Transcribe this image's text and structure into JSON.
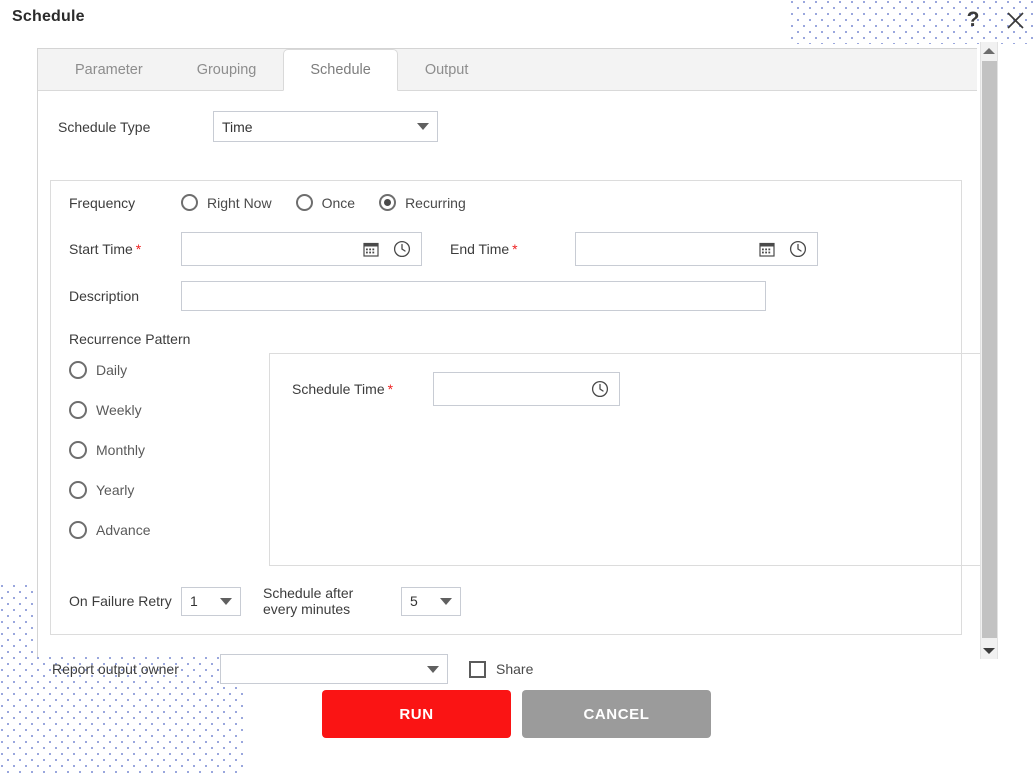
{
  "header": {
    "title": "Schedule",
    "help_icon": "question-mark-icon",
    "close_icon": "close-icon"
  },
  "tabs": [
    {
      "label": "Parameter",
      "active": false
    },
    {
      "label": "Grouping",
      "active": false
    },
    {
      "label": "Schedule",
      "active": true
    },
    {
      "label": "Output",
      "active": false
    }
  ],
  "schedule_type": {
    "label": "Schedule Type",
    "value": "Time"
  },
  "frequency": {
    "label": "Frequency",
    "options": [
      "Right Now",
      "Once",
      "Recurring"
    ],
    "selected": "Recurring"
  },
  "start_time": {
    "label": "Start Time",
    "required": "*",
    "value": "",
    "calendar_icon": "calendar-icon",
    "clock_icon": "clock-icon"
  },
  "end_time": {
    "label": "End Time",
    "required": "*",
    "value": "",
    "calendar_icon": "calendar-icon",
    "clock_icon": "clock-icon"
  },
  "description": {
    "label": "Description",
    "value": ""
  },
  "recurrence_pattern": {
    "label": "Recurrence Pattern",
    "options": [
      "Daily",
      "Weekly",
      "Monthly",
      "Yearly",
      "Advance"
    ],
    "selected": ""
  },
  "schedule_time": {
    "label": "Schedule Time",
    "required": "*",
    "value": "",
    "clock_icon": "clock-icon"
  },
  "on_failure_retry": {
    "label": "On Failure Retry",
    "value": "1"
  },
  "schedule_interval": {
    "label": "Schedule after every minutes",
    "value": "5"
  },
  "report_output_owner": {
    "label": "Report output owner",
    "value": ""
  },
  "share": {
    "label": "Share",
    "checked": false
  },
  "footer": {
    "run_label": "RUN",
    "cancel_label": "CANCEL"
  },
  "colors": {
    "run_red": "#fa1414",
    "cancel_gray": "#9b9b9b",
    "required_red": "#ee2222",
    "dot_pattern": "#9aa7dd"
  },
  "scrollbar": {
    "up_icon": "caret-up-icon",
    "down_icon": "caret-down-icon"
  }
}
